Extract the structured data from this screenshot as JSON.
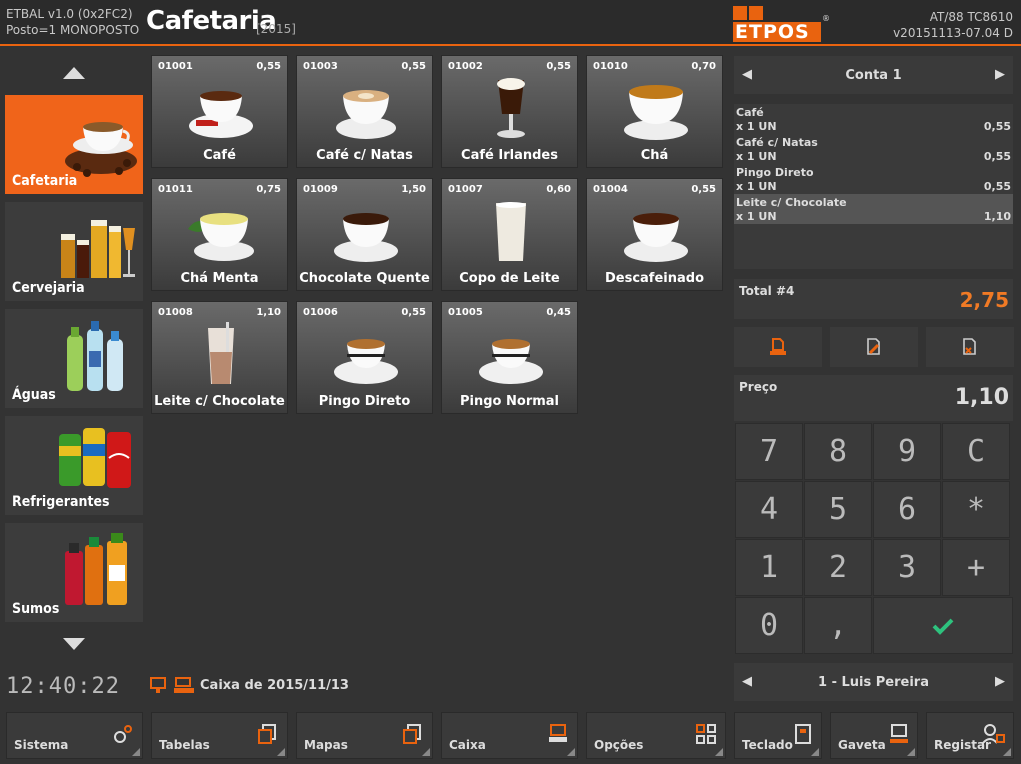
{
  "header": {
    "sys_line1": "ETBAL v1.0 (0x2FC2)",
    "sys_line2": "Posto=1 MONOPOSTO",
    "title": "Cafetaria",
    "year": "[2015]",
    "logo_text": "ETPOS",
    "ver_line1": "AT/88 TC8610",
    "ver_line2": "v20151113-07.04 D"
  },
  "categories": [
    {
      "label": "Cafetaria",
      "icon": "coffee-beans-cup",
      "active": true
    },
    {
      "label": "Cervejaria",
      "icon": "beer-glasses",
      "active": false
    },
    {
      "label": "Águas",
      "icon": "water-bottles",
      "active": false
    },
    {
      "label": "Refrigerantes",
      "icon": "soda-cans",
      "active": false
    },
    {
      "label": "Sumos",
      "icon": "juice-bottles",
      "active": false
    }
  ],
  "products": [
    {
      "code": "01001",
      "price": "0,55",
      "name": "Café"
    },
    {
      "code": "01003",
      "price": "0,55",
      "name": "Café c/ Natas"
    },
    {
      "code": "01002",
      "price": "0,55",
      "name": "Café Irlandes"
    },
    {
      "code": "01010",
      "price": "0,70",
      "name": "Chá"
    },
    {
      "code": "01011",
      "price": "0,75",
      "name": "Chá Menta"
    },
    {
      "code": "01009",
      "price": "1,50",
      "name": "Chocolate Quente"
    },
    {
      "code": "01007",
      "price": "0,60",
      "name": "Copo de Leite"
    },
    {
      "code": "01004",
      "price": "0,55",
      "name": "Descafeinado"
    },
    {
      "code": "01008",
      "price": "1,10",
      "name": "Leite c/ Chocolate"
    },
    {
      "code": "01006",
      "price": "0,55",
      "name": "Pingo Direto"
    },
    {
      "code": "01005",
      "price": "0,45",
      "name": "Pingo Normal"
    }
  ],
  "account": {
    "label": "Conta 1"
  },
  "order": [
    {
      "name": "Café",
      "qty": "x 1 UN",
      "amount": "0,55",
      "selected": false
    },
    {
      "name": "Café c/ Natas",
      "qty": "x 1 UN",
      "amount": "0,55",
      "selected": false
    },
    {
      "name": "Pingo Direto",
      "qty": "x 1 UN",
      "amount": "0,55",
      "selected": false
    },
    {
      "name": "Leite c/ Chocolate",
      "qty": "x 1 UN",
      "amount": "1,10",
      "selected": true
    }
  ],
  "total": {
    "label": "Total #4",
    "value": "2,75"
  },
  "preco": {
    "label": "Preço",
    "value": "1,10"
  },
  "keypad": [
    "7",
    "8",
    "9",
    "C",
    "4",
    "5",
    "6",
    "*",
    "1",
    "2",
    "3",
    "+",
    "0",
    ","
  ],
  "operator": {
    "label": "1 - Luis Pereira"
  },
  "status": {
    "clock": "12:40:22",
    "caixa": "Caixa de 2015/11/13"
  },
  "bottom_buttons": [
    {
      "label": "Sistema",
      "icon": "gears-icon"
    },
    {
      "label": "Tabelas",
      "icon": "tables-icon"
    },
    {
      "label": "Mapas",
      "icon": "maps-icon"
    },
    {
      "label": "Caixa",
      "icon": "cash-icon"
    },
    {
      "label": "Opções",
      "icon": "grid-icon"
    },
    {
      "label": "Teclado",
      "icon": "keyboard-icon"
    },
    {
      "label": "Gaveta",
      "icon": "drawer-icon"
    },
    {
      "label": "Registar",
      "icon": "register-icon"
    }
  ],
  "colors": {
    "accent": "#e9630f",
    "total": "#f07a25",
    "confirm": "#2ec27e"
  }
}
